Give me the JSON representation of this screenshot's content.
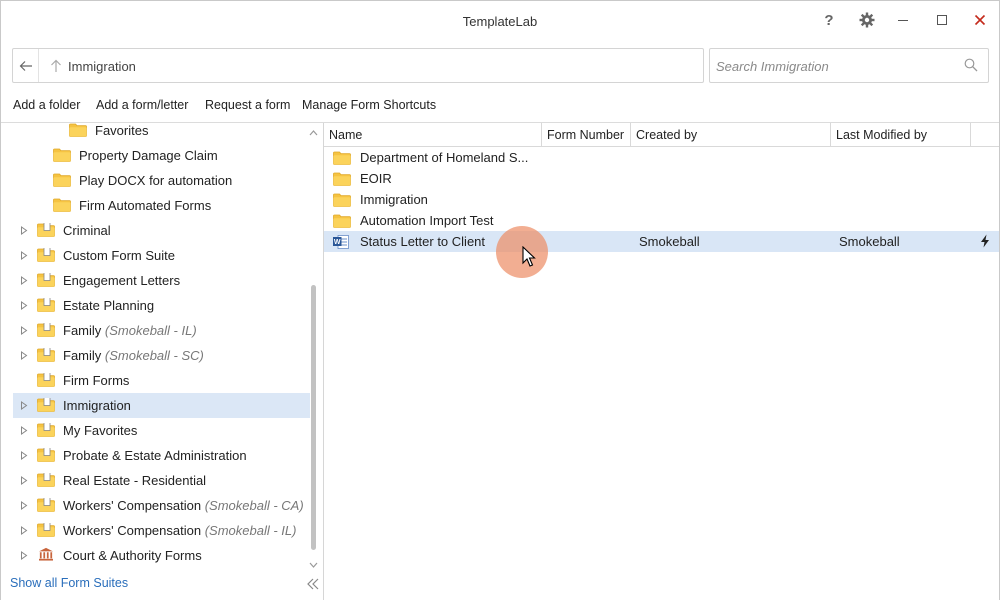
{
  "window": {
    "title": "TemplateLab"
  },
  "titlebar": {
    "help": "?"
  },
  "address": {
    "path": "Immigration"
  },
  "search": {
    "placeholder": "Search Immigration",
    "value": ""
  },
  "toolbar": {
    "add_folder": "Add a folder",
    "add_form": "Add a form/letter",
    "request_form": "Request a form",
    "manage_shortcuts": "Manage Form Shortcuts"
  },
  "tree": {
    "items": [
      {
        "label": "Favorites",
        "suffix": "",
        "icon": "folder-icon",
        "expandable": false,
        "level": 2
      },
      {
        "label": "Property Damage Claim",
        "suffix": "",
        "icon": "folder-icon",
        "expandable": false,
        "level": 1
      },
      {
        "label": "Play DOCX for automation",
        "suffix": "",
        "icon": "folder-icon",
        "expandable": false,
        "level": 1
      },
      {
        "label": "Firm Automated Forms",
        "suffix": "",
        "icon": "folder-icon",
        "expandable": false,
        "level": 1
      },
      {
        "label": "Criminal",
        "suffix": "",
        "icon": "form-suite-icon",
        "expandable": true,
        "level": 0
      },
      {
        "label": "Custom Form Suite",
        "suffix": "",
        "icon": "form-suite-icon",
        "expandable": true,
        "level": 0
      },
      {
        "label": "Engagement Letters",
        "suffix": "",
        "icon": "form-suite-icon",
        "expandable": true,
        "level": 0
      },
      {
        "label": "Estate Planning",
        "suffix": "",
        "icon": "form-suite-icon",
        "expandable": true,
        "level": 0
      },
      {
        "label": "Family",
        "suffix": "(Smokeball - IL)",
        "icon": "form-suite-icon",
        "expandable": true,
        "level": 0
      },
      {
        "label": "Family",
        "suffix": "(Smokeball - SC)",
        "icon": "form-suite-icon",
        "expandable": true,
        "level": 0
      },
      {
        "label": "Firm Forms",
        "suffix": "",
        "icon": "form-suite-icon",
        "expandable": false,
        "level": 0
      },
      {
        "label": "Immigration",
        "suffix": "",
        "icon": "form-suite-icon",
        "expandable": true,
        "level": 0,
        "selected": true
      },
      {
        "label": "My Favorites",
        "suffix": "",
        "icon": "form-suite-icon",
        "expandable": true,
        "level": 0
      },
      {
        "label": "Probate & Estate Administration",
        "suffix": "",
        "icon": "form-suite-icon",
        "expandable": true,
        "level": 0
      },
      {
        "label": "Real Estate - Residential",
        "suffix": "",
        "icon": "form-suite-icon",
        "expandable": true,
        "level": 0
      },
      {
        "label": "Workers' Compensation",
        "suffix": "(Smokeball - CA)",
        "icon": "form-suite-icon",
        "expandable": true,
        "level": 0
      },
      {
        "label": "Workers' Compensation",
        "suffix": "(Smokeball - IL)",
        "icon": "form-suite-icon",
        "expandable": true,
        "level": 0
      },
      {
        "label": "Court & Authority Forms",
        "suffix": "",
        "icon": "court-building-icon",
        "expandable": true,
        "level": 0
      }
    ],
    "show_all": "Show all Form Suites"
  },
  "grid": {
    "columns": [
      "Name",
      "Form Number",
      "Created by",
      "Last Modified by"
    ],
    "rows": [
      {
        "name": "Department of Homeland S...",
        "form_number": "",
        "created_by": "",
        "modified_by": "",
        "icon": "folder-icon"
      },
      {
        "name": "EOIR",
        "form_number": "",
        "created_by": "",
        "modified_by": "",
        "icon": "folder-icon"
      },
      {
        "name": "Immigration",
        "form_number": "",
        "created_by": "",
        "modified_by": "",
        "icon": "folder-icon"
      },
      {
        "name": "Automation Import Test",
        "form_number": "",
        "created_by": "",
        "modified_by": "",
        "icon": "folder-icon"
      },
      {
        "name": "Status Letter to Client",
        "form_number": "",
        "created_by": "Smokeball",
        "modified_by": "Smokeball",
        "icon": "word-doc-icon",
        "automated": true,
        "selected": true
      }
    ]
  },
  "colors": {
    "selection": "#dbe7f6",
    "folder": "#f5c342",
    "link": "#2a6ebb",
    "close": "#c42b1c",
    "cursor_highlight": "#ec8c64"
  }
}
